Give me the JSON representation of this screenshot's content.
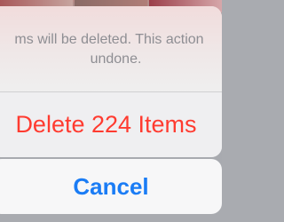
{
  "alert": {
    "message_line_1": "ms will be deleted. This action",
    "message_line_2": "undone."
  },
  "actions": {
    "delete_label": "Delete 224 Items",
    "cancel_label": "Cancel"
  },
  "colors": {
    "destructive": "#ff3b30",
    "primary": "#1a7cf5",
    "message_text": "#8e8e93",
    "sheet_background": "#efeff1"
  }
}
